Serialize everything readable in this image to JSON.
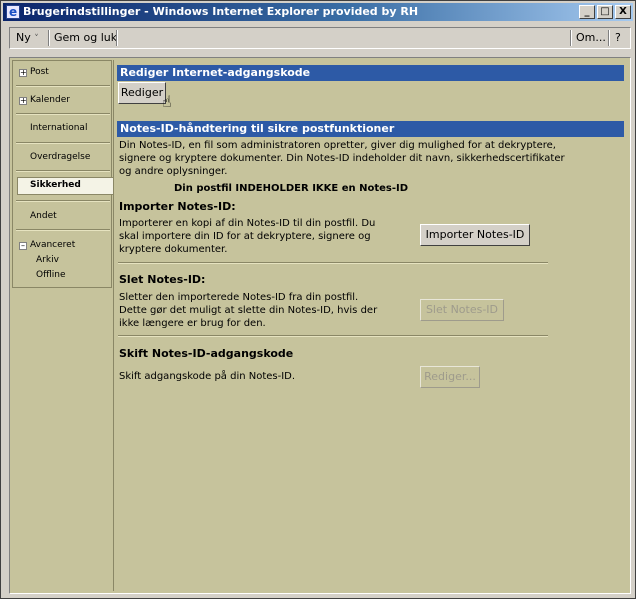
{
  "window": {
    "title": "Brugerindstillinger - Windows Internet Explorer provided by RH",
    "controls": {
      "minimize": "_",
      "maximize": "□",
      "close": "X"
    }
  },
  "toolbar": {
    "new_label": "Ny",
    "new_arrow": "˅",
    "save_close_label": "Gem og luk",
    "about_label": "Om...",
    "help_label": "?"
  },
  "nav": {
    "items": [
      {
        "label": "Post",
        "expander": "+"
      },
      {
        "label": "Kalender",
        "expander": "+"
      },
      {
        "label": "International"
      },
      {
        "label": "Overdragelse"
      },
      {
        "label": "Sikkerhed",
        "active": true
      },
      {
        "label": "Andet"
      },
      {
        "label": "Avanceret",
        "expander": "–"
      }
    ],
    "subitems": [
      {
        "label": "Arkiv"
      },
      {
        "label": "Offline"
      }
    ]
  },
  "main": {
    "password_section": {
      "header": "Rediger Internet-adgangskode",
      "edit_button": "Rediger"
    },
    "notes_section": {
      "header": "Notes-ID-håndtering til sikre postfunktioner",
      "intro_lines": [
        "Din Notes-ID, en fil som administratoren opretter, giver dig mulighed for at dekryptere,",
        "signere og kryptere dokumenter. Din Notes-ID indeholder dit navn, sikkerhedscertifikater",
        "og andre oplysninger."
      ],
      "status": "Din postfil INDEHOLDER IKKE en Notes-ID",
      "import": {
        "title": "Importer Notes-ID:",
        "lines": [
          "Importerer en kopi af din Notes-ID til din postfil. Du",
          "skal importere din ID for at dekryptere, signere og",
          "kryptere dokumenter."
        ],
        "button": "Importer Notes-ID"
      },
      "delete": {
        "title": "Slet Notes-ID:",
        "lines": [
          "Sletter den importerede Notes-ID fra din postfil.",
          "Dette gør det muligt at slette din Notes-ID, hvis der",
          "ikke længere er brug for den."
        ],
        "button": "Slet Notes-ID"
      },
      "change_password": {
        "title": "Skift Notes-ID-adgangskode",
        "line": "Skift adgangskode på din Notes-ID.",
        "button": "Rediger..."
      }
    }
  },
  "colors": {
    "section_header_bg": "#2d5aa6",
    "content_bg": "#c6c39c",
    "titlebar_start": "#0a246a",
    "titlebar_end": "#a6caf0"
  },
  "icons": {
    "title": "ie-icon",
    "cursor": "hand-pointer-icon"
  }
}
